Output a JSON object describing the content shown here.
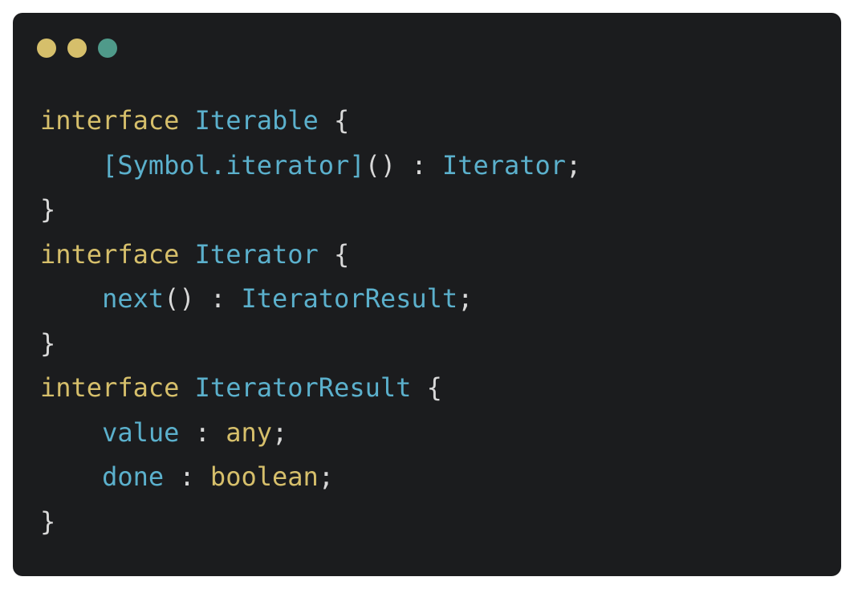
{
  "window": {
    "dots": [
      {
        "name": "close",
        "color": "#d6bf6b"
      },
      {
        "name": "minimize",
        "color": "#d6bf6b"
      },
      {
        "name": "maximize",
        "color": "#4f9a8a"
      }
    ]
  },
  "colors": {
    "background": "#1b1c1e",
    "keyword": "#d6bf6b",
    "type": "#5bb0cc",
    "punctuation": "#d8d8d8"
  },
  "code": {
    "lines": [
      [
        {
          "t": "interface",
          "k": "keyword"
        },
        {
          "t": " ",
          "k": "punct"
        },
        {
          "t": "Iterable",
          "k": "type"
        },
        {
          "t": " {",
          "k": "punct"
        }
      ],
      [
        {
          "t": "    ",
          "k": "punct"
        },
        {
          "t": "[Symbol.iterator]",
          "k": "prop"
        },
        {
          "t": "() : ",
          "k": "punct"
        },
        {
          "t": "Iterator",
          "k": "type"
        },
        {
          "t": ";",
          "k": "punct"
        }
      ],
      [
        {
          "t": "}",
          "k": "punct"
        }
      ],
      [
        {
          "t": "interface",
          "k": "keyword"
        },
        {
          "t": " ",
          "k": "punct"
        },
        {
          "t": "Iterator",
          "k": "type"
        },
        {
          "t": " {",
          "k": "punct"
        }
      ],
      [
        {
          "t": "    ",
          "k": "punct"
        },
        {
          "t": "next",
          "k": "prop"
        },
        {
          "t": "() : ",
          "k": "punct"
        },
        {
          "t": "IteratorResult",
          "k": "type"
        },
        {
          "t": ";",
          "k": "punct"
        }
      ],
      [
        {
          "t": "}",
          "k": "punct"
        }
      ],
      [
        {
          "t": "interface",
          "k": "keyword"
        },
        {
          "t": " ",
          "k": "punct"
        },
        {
          "t": "IteratorResult",
          "k": "type"
        },
        {
          "t": " {",
          "k": "punct"
        }
      ],
      [
        {
          "t": "    ",
          "k": "punct"
        },
        {
          "t": "value",
          "k": "prop"
        },
        {
          "t": " : ",
          "k": "punct"
        },
        {
          "t": "any",
          "k": "keyword"
        },
        {
          "t": ";",
          "k": "punct"
        }
      ],
      [
        {
          "t": "    ",
          "k": "punct"
        },
        {
          "t": "done",
          "k": "prop"
        },
        {
          "t": " : ",
          "k": "punct"
        },
        {
          "t": "boolean",
          "k": "keyword"
        },
        {
          "t": ";",
          "k": "punct"
        }
      ],
      [
        {
          "t": "}",
          "k": "punct"
        }
      ]
    ]
  }
}
